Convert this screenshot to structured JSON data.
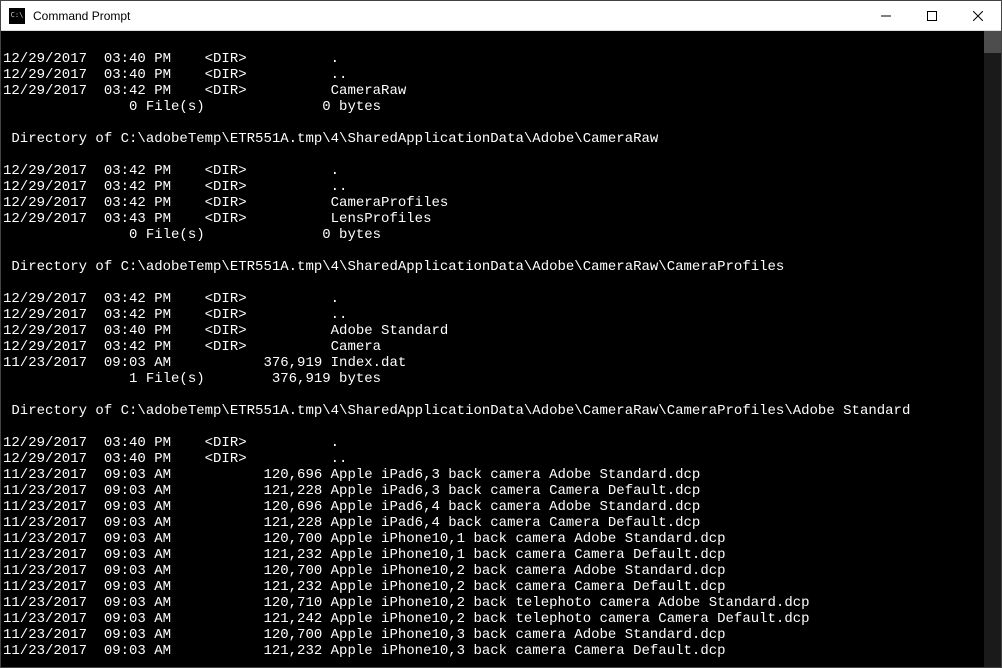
{
  "window": {
    "title": "Command Prompt"
  },
  "terminal_lines": [
    "",
    "12/29/2017  03:40 PM    <DIR>          .",
    "12/29/2017  03:40 PM    <DIR>          ..",
    "12/29/2017  03:42 PM    <DIR>          CameraRaw",
    "               0 File(s)              0 bytes",
    "",
    " Directory of C:\\adobeTemp\\ETR551A.tmp\\4\\SharedApplicationData\\Adobe\\CameraRaw",
    "",
    "12/29/2017  03:42 PM    <DIR>          .",
    "12/29/2017  03:42 PM    <DIR>          ..",
    "12/29/2017  03:42 PM    <DIR>          CameraProfiles",
    "12/29/2017  03:43 PM    <DIR>          LensProfiles",
    "               0 File(s)              0 bytes",
    "",
    " Directory of C:\\adobeTemp\\ETR551A.tmp\\4\\SharedApplicationData\\Adobe\\CameraRaw\\CameraProfiles",
    "",
    "12/29/2017  03:42 PM    <DIR>          .",
    "12/29/2017  03:42 PM    <DIR>          ..",
    "12/29/2017  03:40 PM    <DIR>          Adobe Standard",
    "12/29/2017  03:42 PM    <DIR>          Camera",
    "11/23/2017  09:03 AM           376,919 Index.dat",
    "               1 File(s)        376,919 bytes",
    "",
    " Directory of C:\\adobeTemp\\ETR551A.tmp\\4\\SharedApplicationData\\Adobe\\CameraRaw\\CameraProfiles\\Adobe Standard",
    "",
    "12/29/2017  03:40 PM    <DIR>          .",
    "12/29/2017  03:40 PM    <DIR>          ..",
    "11/23/2017  09:03 AM           120,696 Apple iPad6,3 back camera Adobe Standard.dcp",
    "11/23/2017  09:03 AM           121,228 Apple iPad6,3 back camera Camera Default.dcp",
    "11/23/2017  09:03 AM           120,696 Apple iPad6,4 back camera Adobe Standard.dcp",
    "11/23/2017  09:03 AM           121,228 Apple iPad6,4 back camera Camera Default.dcp",
    "11/23/2017  09:03 AM           120,700 Apple iPhone10,1 back camera Adobe Standard.dcp",
    "11/23/2017  09:03 AM           121,232 Apple iPhone10,1 back camera Camera Default.dcp",
    "11/23/2017  09:03 AM           120,700 Apple iPhone10,2 back camera Adobe Standard.dcp",
    "11/23/2017  09:03 AM           121,232 Apple iPhone10,2 back camera Camera Default.dcp",
    "11/23/2017  09:03 AM           120,710 Apple iPhone10,2 back telephoto camera Adobe Standard.dcp",
    "11/23/2017  09:03 AM           121,242 Apple iPhone10,2 back telephoto camera Camera Default.dcp",
    "11/23/2017  09:03 AM           120,700 Apple iPhone10,3 back camera Adobe Standard.dcp",
    "11/23/2017  09:03 AM           121,232 Apple iPhone10,3 back camera Camera Default.dcp"
  ]
}
